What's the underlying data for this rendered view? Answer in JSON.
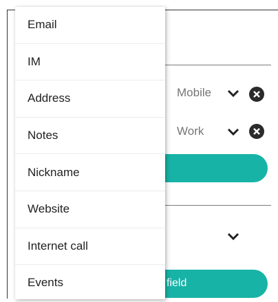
{
  "menu": {
    "items": [
      {
        "label": "Email"
      },
      {
        "label": "IM"
      },
      {
        "label": "Address"
      },
      {
        "label": "Notes"
      },
      {
        "label": "Nickname"
      },
      {
        "label": "Website"
      },
      {
        "label": "Internet call"
      },
      {
        "label": "Events"
      }
    ]
  },
  "background_form": {
    "phone_type_1": "Mobile",
    "phone_type_2": "Work",
    "add_field_button_text": "field"
  },
  "colors": {
    "accent": "#17b3a6",
    "clear_button": "#2b2b2b"
  }
}
